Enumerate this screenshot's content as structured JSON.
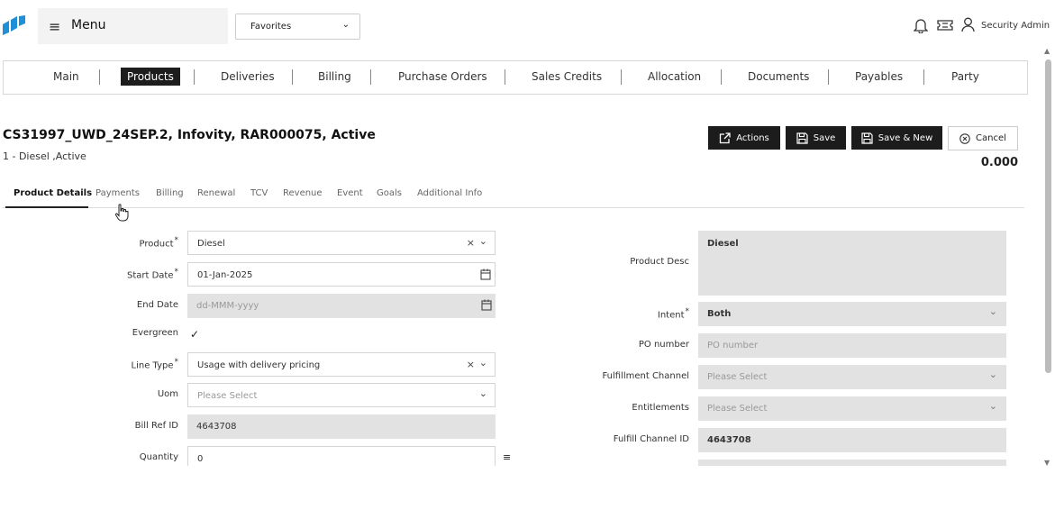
{
  "header": {
    "menu_icon": "≡",
    "menu_label": "Menu",
    "favorites_value": "Favorites",
    "user_name": "Security Admin"
  },
  "nav": {
    "items": [
      "Main",
      "Products",
      "Deliveries",
      "Billing",
      "Purchase Orders",
      "Sales Credits",
      "Allocation",
      "Documents",
      "Payables",
      "Party"
    ],
    "active": "Products"
  },
  "record": {
    "title": "CS31997_UWD_24SEP.2, Infovity, RAR000075, Active",
    "subtitle": "1 - Diesel ,Active",
    "total": "0.000"
  },
  "actions": {
    "actions_label": "Actions",
    "save_label": "Save",
    "save_new_label": "Save & New",
    "cancel_label": "Cancel"
  },
  "tabs": {
    "items": [
      "Product Details",
      "Payments",
      "Billing",
      "Renewal",
      "TCV",
      "Revenue",
      "Event",
      "Goals",
      "Additional Info"
    ],
    "active": "Product Details"
  },
  "form": {
    "product_label": "Product",
    "product_value": "Diesel",
    "start_date_label": "Start Date",
    "start_date_value": "01-Jan-2025",
    "end_date_label": "End Date",
    "end_date_placeholder": "dd-MMM-yyyy",
    "evergreen_label": "Evergreen",
    "evergreen_checked": true,
    "line_type_label": "Line Type",
    "line_type_value": "Usage with delivery pricing",
    "uom_label": "Uom",
    "uom_placeholder": "Please Select",
    "bill_ref_label": "Bill Ref ID",
    "bill_ref_value": "4643708",
    "quantity_label": "Quantity",
    "quantity_value": "0",
    "product_desc_label": "Product Desc",
    "product_desc_value": "Diesel",
    "intent_label": "Intent",
    "intent_value": "Both",
    "po_number_label": "PO number",
    "po_number_placeholder": "PO number",
    "fulfillment_channel_label": "Fulfillment Channel",
    "fulfillment_channel_placeholder": "Please Select",
    "entitlements_label": "Entitlements",
    "entitlements_placeholder": "Please Select",
    "fulfill_channel_id_label": "Fulfill Channel ID",
    "fulfill_channel_id_value": "4643708",
    "required_mark": "*",
    "clear_glyph": "×",
    "chevron_glyph": "⌄",
    "list_glyph": "≡",
    "check_glyph": "✓"
  },
  "colors": {
    "accent_blue": "#1f8fd6",
    "dark_button": "#1c1c1c",
    "readonly_field": "#e2e2e2"
  }
}
